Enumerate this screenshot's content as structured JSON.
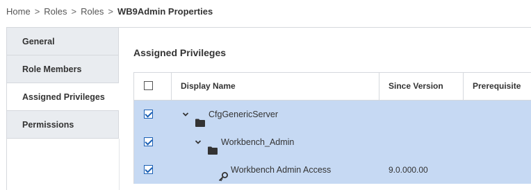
{
  "breadcrumb": {
    "items": [
      "Home",
      "Roles",
      "Roles"
    ],
    "separator": ">",
    "current": "WB9Admin Properties"
  },
  "sidebar": {
    "items": [
      {
        "label": "General"
      },
      {
        "label": "Role Members"
      },
      {
        "label": "Assigned Privileges"
      },
      {
        "label": "Permissions"
      }
    ],
    "active": "Assigned Privileges"
  },
  "main": {
    "title": "Assigned Privileges",
    "table": {
      "columns": [
        "Display Name",
        "Since Version",
        "Prerequisite"
      ],
      "rows": [
        {
          "name": "CfgGenericServer",
          "version": "",
          "prerequisite": "",
          "checked": true,
          "type": "folder",
          "expanded": true
        },
        {
          "name": "Workbench_Admin",
          "version": "",
          "prerequisite": "",
          "checked": true,
          "type": "folder",
          "expanded": true
        },
        {
          "name": "Workbench Admin Access",
          "version": "9.0.000.00",
          "prerequisite": "",
          "checked": true,
          "type": "privilege"
        }
      ]
    }
  },
  "colors": {
    "selected_row": "#c6d9f3",
    "sidebar_bg": "#e9ecf0",
    "checkbox_accent": "#1a5fb4"
  },
  "icons": {
    "folder": "folder-icon",
    "key": "key-icon",
    "expand": "chevron-down-icon"
  }
}
